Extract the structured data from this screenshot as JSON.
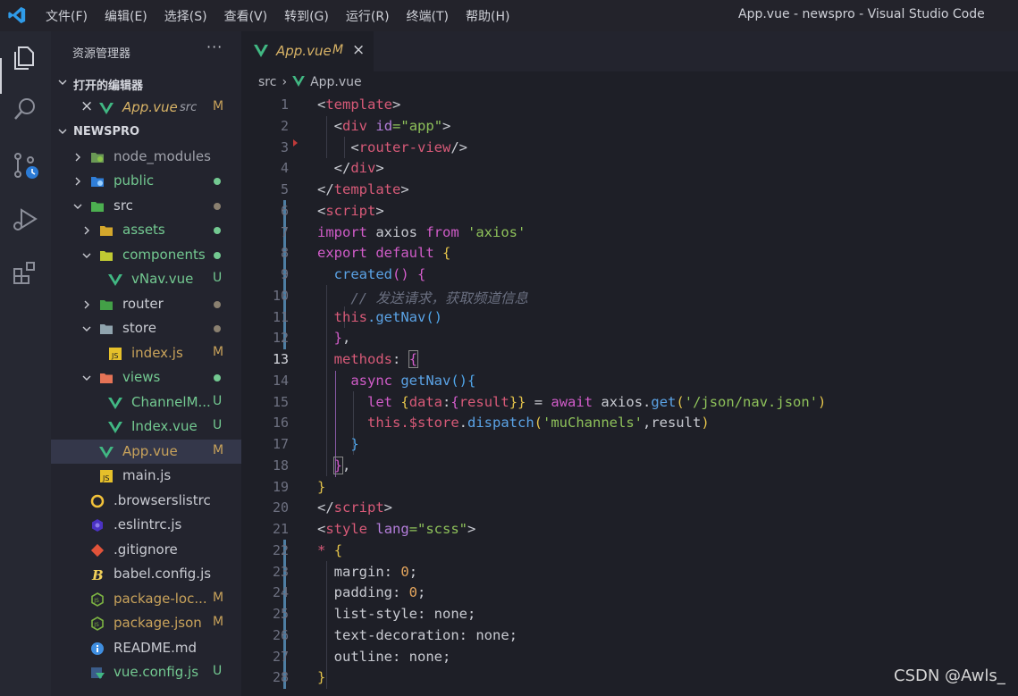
{
  "titlebar": {
    "menu": [
      "文件(F)",
      "编辑(E)",
      "选择(S)",
      "查看(V)",
      "转到(G)",
      "运行(R)",
      "终端(T)",
      "帮助(H)"
    ],
    "window_title": "App.vue - newspro - Visual Studio Code"
  },
  "activitybar": {
    "icons": [
      "explorer-icon",
      "search-icon",
      "source-control-icon",
      "run-debug-icon",
      "extensions-icon"
    ]
  },
  "sidebar": {
    "title": "资源管理器",
    "more": "···",
    "open_editors_label": "打开的编辑器",
    "open_editor": {
      "name": "App.vue",
      "folder": "src",
      "status": "M"
    },
    "project_label": "NEWSPRO",
    "tree": [
      {
        "name": "node_modules",
        "status": ""
      },
      {
        "name": "public",
        "status": ""
      },
      {
        "name": "src",
        "status": ""
      },
      {
        "name": "assets",
        "status": ""
      },
      {
        "name": "components",
        "status": ""
      },
      {
        "name": "vNav.vue",
        "status": "U"
      },
      {
        "name": "router",
        "status": ""
      },
      {
        "name": "store",
        "status": ""
      },
      {
        "name": "index.js",
        "status": "M"
      },
      {
        "name": "views",
        "status": ""
      },
      {
        "name": "ChannelM...",
        "status": "U"
      },
      {
        "name": "Index.vue",
        "status": "U"
      },
      {
        "name": "App.vue",
        "status": "M"
      },
      {
        "name": "main.js",
        "status": ""
      },
      {
        "name": ".browserslistrc",
        "status": ""
      },
      {
        "name": ".eslintrc.js",
        "status": ""
      },
      {
        "name": ".gitignore",
        "status": ""
      },
      {
        "name": "babel.config.js",
        "status": ""
      },
      {
        "name": "package-loc...",
        "status": "M"
      },
      {
        "name": "package.json",
        "status": "M"
      },
      {
        "name": "README.md",
        "status": ""
      },
      {
        "name": "vue.config.js",
        "status": "U"
      }
    ]
  },
  "editor": {
    "tab": {
      "name": "App.vue",
      "status": "M",
      "close": "×"
    },
    "breadcrumb": [
      "src",
      "App.vue"
    ],
    "line_numbers": [
      "1",
      "2",
      "3",
      "4",
      "5",
      "6",
      "7",
      "8",
      "9",
      "10",
      "11",
      "12",
      "13",
      "14",
      "15",
      "16",
      "17",
      "18",
      "19",
      "20",
      "21",
      "22",
      "23",
      "24",
      "25",
      "26",
      "27",
      "28"
    ],
    "code": {
      "l1": [
        "<",
        "template",
        ">"
      ],
      "l2": [
        "<",
        "div",
        "id",
        "=\"app\"",
        ">"
      ],
      "l3": [
        "<",
        "router-view",
        "/>"
      ],
      "l4": [
        "</",
        "div",
        ">"
      ],
      "l5": [
        "</",
        "template",
        ">"
      ],
      "l6": [
        "<",
        "script",
        ">"
      ],
      "l7": [
        "import",
        " axios ",
        "from",
        "'axios'"
      ],
      "l8": [
        "export",
        "default",
        "{"
      ],
      "l9": [
        "created",
        "()",
        "{"
      ],
      "l10": "// 发送请求，获取频道信息",
      "l11": [
        "this",
        ".getNav",
        "()"
      ],
      "l12": [
        "}",
        ","
      ],
      "l13": [
        "methods",
        ":",
        "{"
      ],
      "l14": [
        "async",
        "getNav",
        "(){"
      ],
      "l15": [
        "let",
        "{",
        "data",
        ":",
        "{",
        "result",
        "}}",
        " = ",
        "await",
        " axios",
        ".",
        "get",
        "(",
        "'/json/nav.json'",
        ")"
      ],
      "l16": [
        "this",
        ".$store",
        ".",
        "dispatch",
        "(",
        "'muChannels'",
        ",result",
        ")"
      ],
      "l17": "}",
      "l18": [
        "}",
        ","
      ],
      "l19": "}",
      "l20": [
        "</",
        "script",
        ">"
      ],
      "l21": [
        "<",
        "style",
        "lang",
        "=\"scss\"",
        ">"
      ],
      "l22": [
        "*",
        "{"
      ],
      "l23": [
        "margin",
        ": ",
        "0",
        ";"
      ],
      "l24": [
        "padding",
        ": ",
        "0",
        ";"
      ],
      "l25": [
        "list-style",
        ": none;"
      ],
      "l26": [
        "text-decoration",
        ": none;"
      ],
      "l27": [
        "outline",
        ": none;"
      ],
      "l28": "}"
    }
  },
  "watermark": "CSDN @Awls_",
  "colors": {
    "accent_vue": "#41b883",
    "modified": "#c9a35b",
    "untracked": "#73c991"
  }
}
